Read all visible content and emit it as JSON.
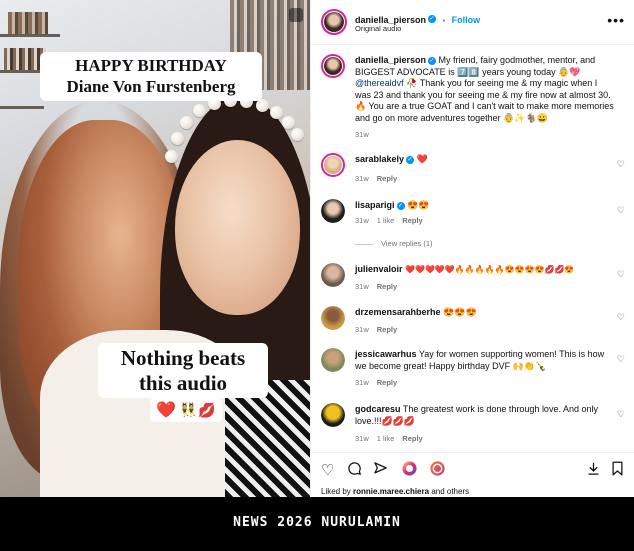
{
  "media": {
    "caption_top_line1": "HAPPY BIRTHDAY",
    "caption_top_line2": "Diane Von Furstenberg",
    "caption_bottom_line1": "Nothing beats",
    "caption_bottom_line2": "this audio",
    "emoji_heart": "❤️",
    "emoji_dancers": "👯",
    "emoji_lips": "💋"
  },
  "header": {
    "username": "daniella_pierson",
    "verified_mark": "✓",
    "separator": "•",
    "follow_label": "Follow",
    "audio_label": "Original audio",
    "more_icon": "more-horizontal-icon"
  },
  "post": {
    "username": "daniella_pierson",
    "text_line1_after_user": "My friend, fairy godmother, mentor, and",
    "text_line2": "BIGGEST ADVOCATE is 7️⃣8️⃣ years young today 👵💖",
    "mention": "@therealdvf",
    "text_line3_after_mention": "🥀 Thank you for seeing me & my magic when I",
    "text_line4": "was 23 and thank you for seeing me & my fire now at almost 30.",
    "text_line5": "🔥 You are a true GOAT and I can't wait to make more memories",
    "text_line6": "and go on more adventures together 👵✨🐐😀",
    "time": "31w"
  },
  "comments": [
    {
      "username": "sarablakely",
      "verified": true,
      "text": "❤️",
      "time": "31w",
      "likes": "",
      "reply": "Reply"
    },
    {
      "username": "lisaparigi",
      "verified": true,
      "text": "😍😍",
      "time": "31w",
      "likes": "1 like",
      "reply": "Reply"
    },
    {
      "username": "julienvaloir",
      "verified": false,
      "text": "❤️❤️❤️❤️❤️🔥🔥🔥🔥🔥😍😍😍😍💋💋😍",
      "time": "31w",
      "likes": "",
      "reply": "Reply"
    },
    {
      "username": "drzemensarahberhe",
      "verified": false,
      "text": "😍😍😍",
      "time": "31w",
      "likes": "",
      "reply": "Reply"
    },
    {
      "username": "jessicawarhus",
      "verified": false,
      "text_line1": "Yay for women supporting women! This is how",
      "text_line2": "we become great! Happy birthday DVF 🙌👏🍾",
      "time": "31w",
      "likes": "",
      "reply": "Reply"
    },
    {
      "username": "godcaresu",
      "verified": false,
      "text_line1": "The greatest work is done through love. And only",
      "text_line2": "love.!!!💋💋💋",
      "time": "31w",
      "likes": "1 like",
      "reply": "Reply"
    }
  ],
  "view_replies": "View replies (1)",
  "actions": {
    "like_icon": "heart-outline-icon",
    "comment_icon": "comment-icon",
    "share_icon": "send-icon",
    "download_icon": "download-icon",
    "save_icon": "bookmark-icon"
  },
  "liked_by": {
    "prefix": "Liked by",
    "user": "ronnie.maree.chiera",
    "suffix": "and others"
  },
  "footer": {
    "watermark": "NEWS 2026 NURULAMIN"
  },
  "colors": {
    "accent_blue": "#0095f6",
    "mention_blue": "#00376b",
    "ring_pink": "#d6249f",
    "footer_bg": "#000000"
  }
}
